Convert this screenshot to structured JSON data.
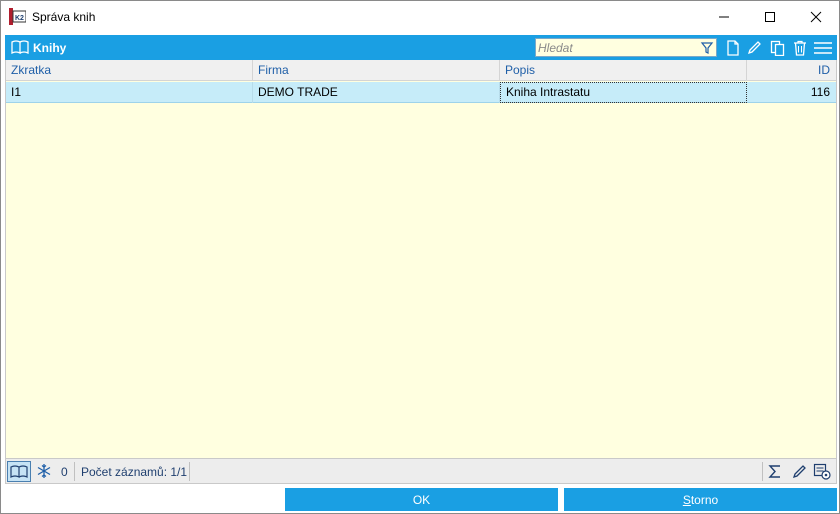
{
  "window": {
    "title": "Správa knih",
    "icon": "k2-app-icon",
    "controls": [
      "minimize-icon",
      "maximize-icon",
      "close-icon"
    ]
  },
  "panel": {
    "title": "Knihy",
    "icon": "book-icon",
    "search_placeholder": "Hledat",
    "toolbar": [
      "new-document-icon",
      "edit-pencil-icon",
      "copy-icon",
      "delete-trash-icon",
      "menu-hamburger-icon"
    ]
  },
  "grid": {
    "columns": [
      "Zkratka",
      "Firma",
      "Popis",
      "ID"
    ],
    "rows": [
      {
        "zkratka": "I1",
        "firma": "DEMO TRADE",
        "popis": "Kniha Intrastatu",
        "id": "116"
      }
    ]
  },
  "status": {
    "count_zero": "0",
    "records_label": "Počet záznamů: 1/1",
    "right_icons": [
      "sum-sigma-icon",
      "edit-pencil-icon",
      "settings-list-icon"
    ]
  },
  "buttons": {
    "ok": "OK",
    "storno_first": "S",
    "storno_rest": "torno"
  },
  "colors": {
    "accent": "#1a9fe3",
    "grid_background": "#ffffe0",
    "selected_row": "#c6ecf9",
    "column_header_text": "#1f5fa8"
  }
}
